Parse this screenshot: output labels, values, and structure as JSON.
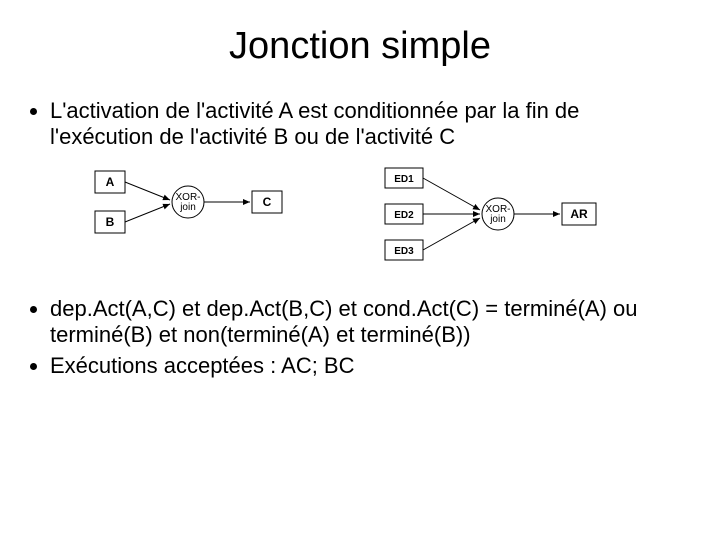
{
  "title": "Jonction simple",
  "bullets_top": [
    "L'activation de l'activité A est conditionnée par la fin de l'exécution de l'activité B ou de l'activité C"
  ],
  "bullets_bottom": [
    "dep.Act(A,C) et dep.Act(B,C) et cond.Act(C) = terminé(A) ou terminé(B) et non(terminé(A) et terminé(B))",
    "Exécutions acceptées : AC; BC"
  ],
  "diagram1": {
    "left_top": "A",
    "left_bottom": "B",
    "join": "XOR-join",
    "right": "C"
  },
  "diagram2": {
    "left1": "ED1",
    "left2": "ED2",
    "left3": "ED3",
    "join": "XOR-join",
    "right": "AR"
  }
}
